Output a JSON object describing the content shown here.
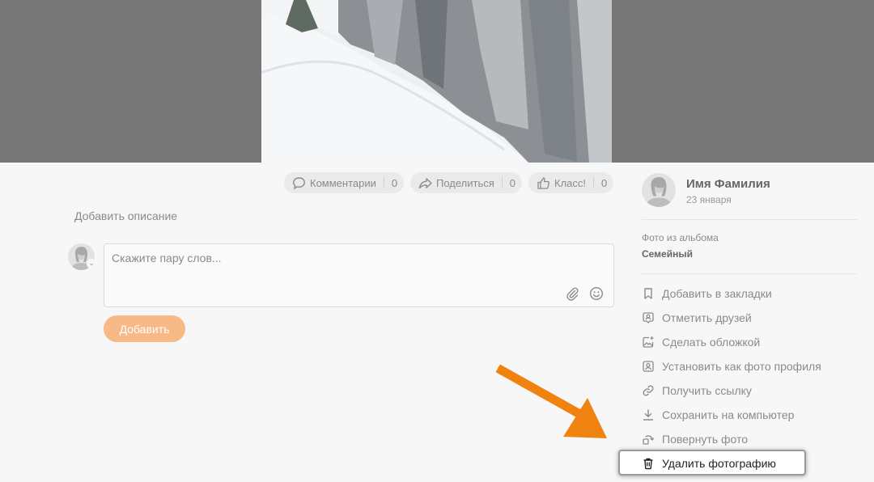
{
  "photo": {
    "alt": "snowy rock cliff"
  },
  "actions": {
    "comments": {
      "label": "Комментарии",
      "count": "0"
    },
    "share": {
      "label": "Поделиться",
      "count": "0"
    },
    "like": {
      "label": "Класс!",
      "count": "0"
    }
  },
  "description": {
    "add_label": "Добавить описание"
  },
  "comment": {
    "placeholder": "Скажите пару слов...",
    "submit_label": "Добавить"
  },
  "author": {
    "name": "Имя Фамилия",
    "date": "23 января"
  },
  "album": {
    "caption": "Фото из альбома",
    "name": "Семейный"
  },
  "menu": {
    "items": [
      {
        "label": "Добавить в закладки",
        "icon": "bookmark-icon"
      },
      {
        "label": "Отметить друзей",
        "icon": "tag-friends-icon"
      },
      {
        "label": "Сделать обложкой",
        "icon": "cover-image-icon"
      },
      {
        "label": "Установить как фото профиля",
        "icon": "profile-photo-icon"
      },
      {
        "label": "Получить ссылку",
        "icon": "link-icon"
      },
      {
        "label": "Сохранить на компьютер",
        "icon": "download-icon"
      },
      {
        "label": "Повернуть фото",
        "icon": "rotate-icon"
      }
    ],
    "delete": {
      "label": "Удалить фотографию",
      "icon": "trash-icon"
    }
  },
  "colors": {
    "accent": "#f7b986",
    "annotation": "#f0820f",
    "viewer_bg": "#777777"
  }
}
